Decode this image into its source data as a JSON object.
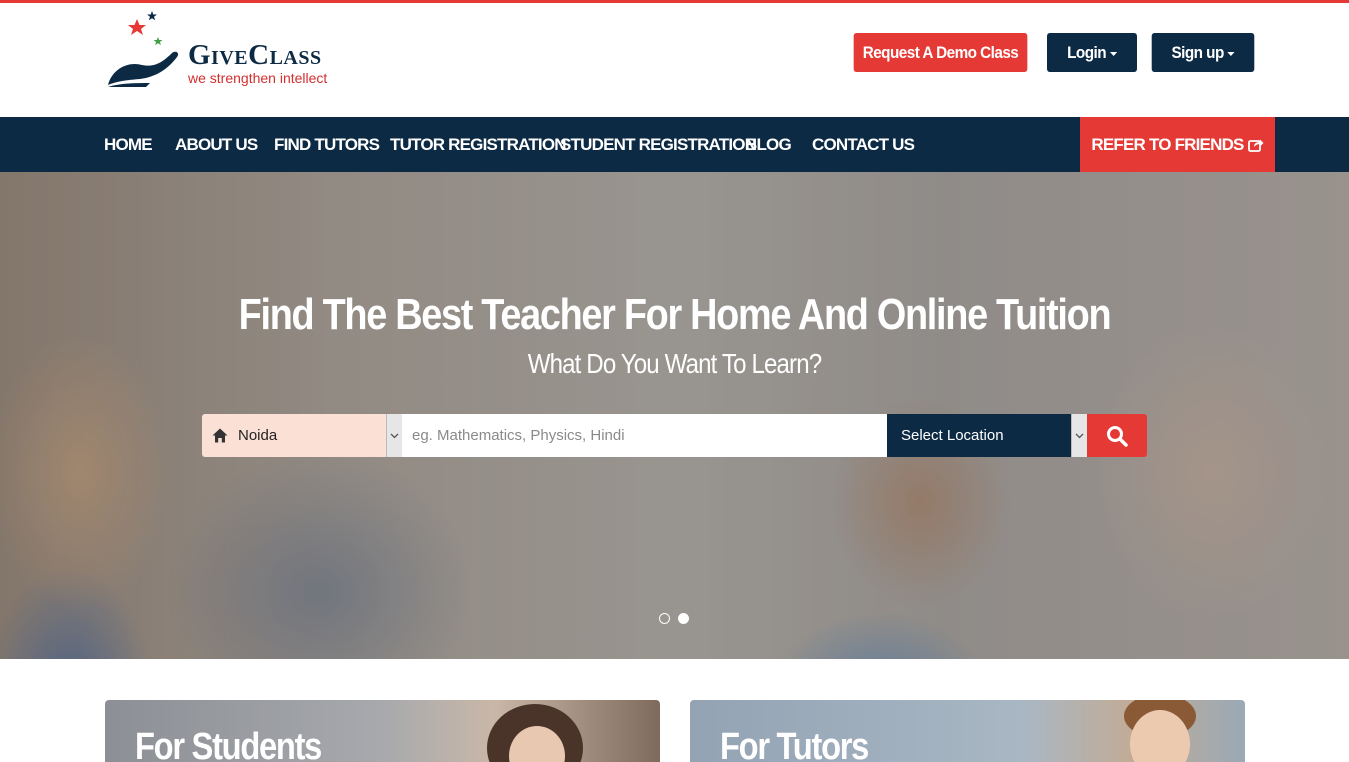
{
  "brand": {
    "name": "GiveClass",
    "tagline": "we strengthen intellect",
    "colors": {
      "primary_navy": "#0d2a45",
      "accent_red": "#e53935"
    }
  },
  "header": {
    "demo_button": "Request A Demo Class",
    "login_button": "Login",
    "signup_button": "Sign up"
  },
  "nav": {
    "items": [
      "HOME",
      "ABOUT US",
      "FIND TUTORS",
      "TUTOR REGISTRATION",
      "STUDENT REGISTRATION",
      "BLOG",
      "CONTACT US"
    ],
    "refer": "REFER TO FRIENDS"
  },
  "hero": {
    "title": "Find The Best Teacher For Home And Online Tuition",
    "subtitle": "What Do You Want To Learn?",
    "search": {
      "city_value": "Noida",
      "subject_placeholder": "eg. Mathematics, Physics, Hindi",
      "location_value": "Select Location"
    },
    "slides": {
      "count": 2,
      "active": 2
    }
  },
  "cards": [
    {
      "title": "For Students"
    },
    {
      "title": "For Tutors"
    }
  ],
  "icons": {
    "logo": "stars-hand-logo",
    "caret": "caret-down-icon",
    "share": "share-icon",
    "home": "home-icon",
    "search": "search-icon"
  }
}
